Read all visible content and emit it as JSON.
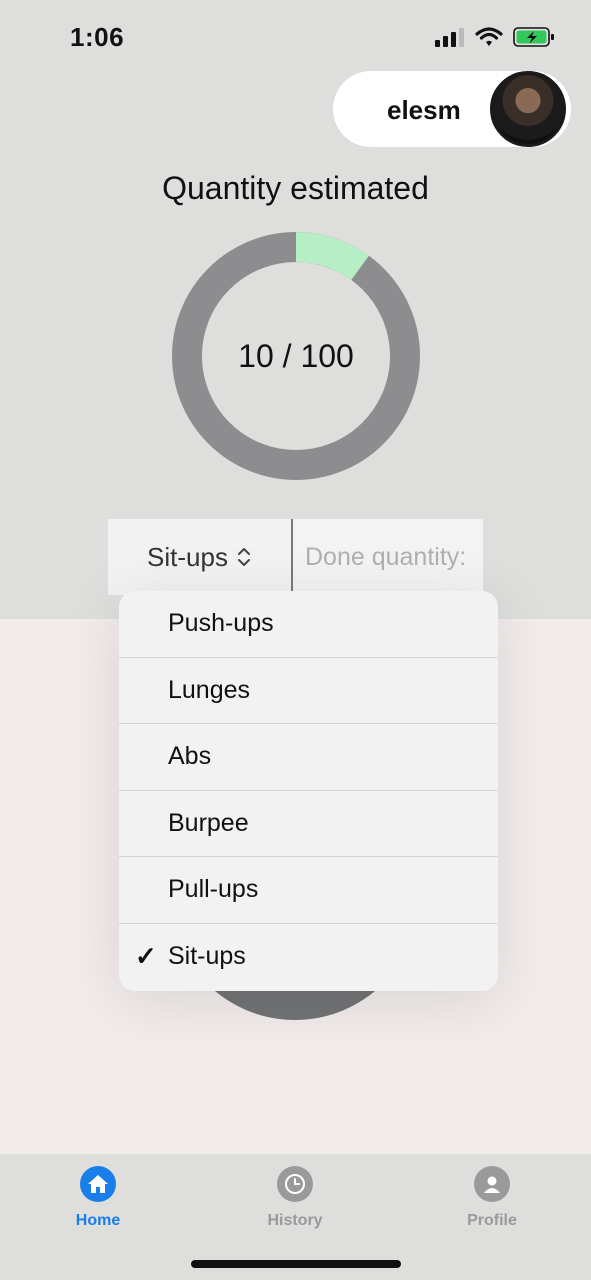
{
  "status_bar": {
    "time": "1:06"
  },
  "user": {
    "name": "elesm"
  },
  "main": {
    "title": "Quantity estimated",
    "progress": {
      "done": 10,
      "total": 100,
      "label": "10 / 100"
    }
  },
  "exercise_select": {
    "selected": "Sit-ups",
    "chevron": "⌃⌄"
  },
  "done_input": {
    "placeholder": "Done quantity:"
  },
  "menu": {
    "items": [
      {
        "label": "Push-ups",
        "checked": false
      },
      {
        "label": "Lunges",
        "checked": false
      },
      {
        "label": "Abs",
        "checked": false
      },
      {
        "label": "Burpee",
        "checked": false
      },
      {
        "label": "Pull-ups",
        "checked": false
      },
      {
        "label": "Sit-ups",
        "checked": true
      }
    ],
    "check_glyph": "✓"
  },
  "tabs": [
    {
      "label": "Home",
      "icon": "home-icon",
      "active": true
    },
    {
      "label": "History",
      "icon": "clock-icon",
      "active": false
    },
    {
      "label": "Profile",
      "icon": "person-icon",
      "active": false
    }
  ],
  "colors": {
    "progress_done": "#b6eec6",
    "progress_remaining": "#8d8d90",
    "tab_active": "#1a7ee8",
    "tab_inactive": "#9a9a9a"
  }
}
